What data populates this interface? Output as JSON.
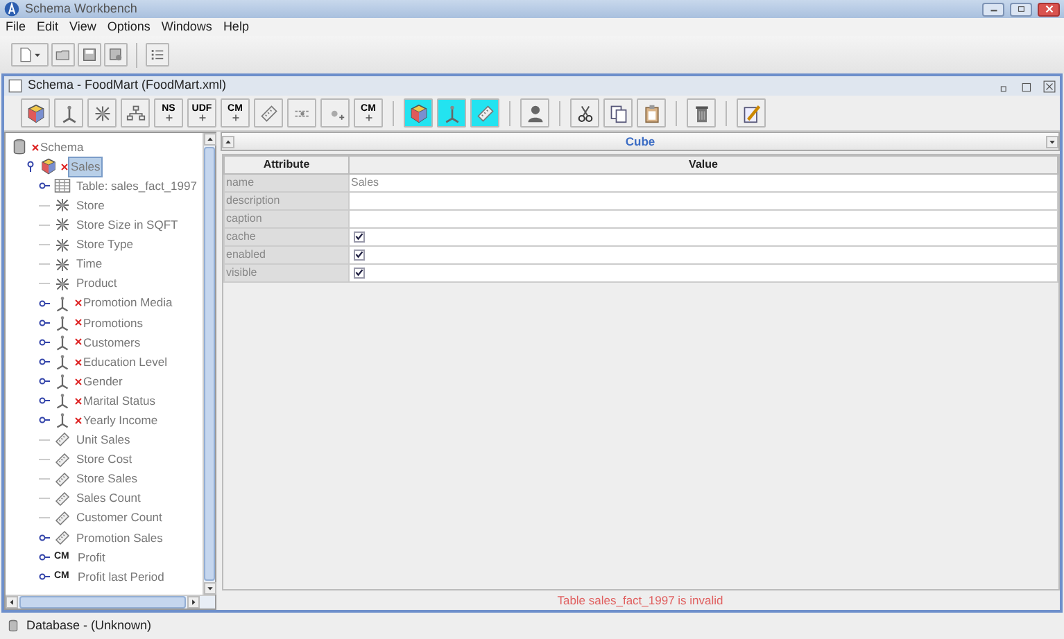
{
  "window": {
    "title": "Schema Workbench"
  },
  "menu": [
    {
      "label": "File"
    },
    {
      "label": "Edit"
    },
    {
      "label": "View"
    },
    {
      "label": "Options"
    },
    {
      "label": "Windows"
    },
    {
      "label": "Help"
    }
  ],
  "main_toolbar": [
    {
      "kind": "new-menu"
    },
    {
      "kind": "open"
    },
    {
      "kind": "save"
    },
    {
      "kind": "save-as"
    },
    {
      "kind": "sep"
    },
    {
      "kind": "preferences"
    }
  ],
  "frame": {
    "title": "Schema - FoodMart (FoodMart.xml)"
  },
  "frame_toolbar": [
    {
      "kind": "cube",
      "highlighted": false
    },
    {
      "kind": "dimension",
      "highlighted": false
    },
    {
      "kind": "star",
      "highlighted": false
    },
    {
      "kind": "hierarchy",
      "highlighted": false
    },
    {
      "kind": "text",
      "label": "NS",
      "highlighted": false
    },
    {
      "kind": "text",
      "label": "UDF",
      "highlighted": false
    },
    {
      "kind": "text",
      "label": "CM",
      "highlighted": false
    },
    {
      "kind": "measure",
      "highlighted": false
    },
    {
      "kind": "level",
      "highlighted": false
    },
    {
      "kind": "property",
      "highlighted": false
    },
    {
      "kind": "text",
      "label": "CM",
      "highlighted": false
    },
    {
      "kind": "sep"
    },
    {
      "kind": "cube",
      "highlighted": true
    },
    {
      "kind": "dimension",
      "highlighted": true
    },
    {
      "kind": "measure",
      "highlighted": true
    },
    {
      "kind": "sep"
    },
    {
      "kind": "person",
      "highlighted": false
    },
    {
      "kind": "sep"
    },
    {
      "kind": "cut",
      "highlighted": false
    },
    {
      "kind": "copy",
      "highlighted": false
    },
    {
      "kind": "paste",
      "highlighted": false
    },
    {
      "kind": "sep"
    },
    {
      "kind": "delete",
      "highlighted": false
    },
    {
      "kind": "sep"
    },
    {
      "kind": "edit",
      "highlighted": false
    }
  ],
  "tree": [
    {
      "label": "Schema",
      "kind": "schema",
      "invalid": true,
      "selected": false,
      "children": [
        {
          "label": "Sales",
          "kind": "cube",
          "invalid": true,
          "selected": true,
          "expanded": true,
          "children": [
            {
              "label": "Table: sales_fact_1997",
              "kind": "table",
              "invalid": false,
              "selected": false,
              "expanded": false
            },
            {
              "label": "Store",
              "kind": "shared",
              "invalid": false,
              "selected": false
            },
            {
              "label": "Store Size in SQFT",
              "kind": "shared",
              "invalid": false,
              "selected": false
            },
            {
              "label": "Store Type",
              "kind": "shared",
              "invalid": false,
              "selected": false
            },
            {
              "label": "Time",
              "kind": "shared",
              "invalid": false,
              "selected": false
            },
            {
              "label": "Product",
              "kind": "shared",
              "invalid": false,
              "selected": false
            },
            {
              "label": "Promotion Media",
              "kind": "dimension",
              "invalid": true,
              "selected": false,
              "expanded": false
            },
            {
              "label": "Promotions",
              "kind": "dimension",
              "invalid": true,
              "selected": false,
              "expanded": false
            },
            {
              "label": "Customers",
              "kind": "dimension",
              "invalid": true,
              "selected": false,
              "expanded": false
            },
            {
              "label": "Education Level",
              "kind": "dimension",
              "invalid": true,
              "selected": false,
              "expanded": false
            },
            {
              "label": "Gender",
              "kind": "dimension",
              "invalid": true,
              "selected": false,
              "expanded": false
            },
            {
              "label": "Marital Status",
              "kind": "dimension",
              "invalid": true,
              "selected": false,
              "expanded": false
            },
            {
              "label": "Yearly Income",
              "kind": "dimension",
              "invalid": true,
              "selected": false,
              "expanded": false
            },
            {
              "label": "Unit Sales",
              "kind": "measure",
              "invalid": false,
              "selected": false
            },
            {
              "label": "Store Cost",
              "kind": "measure",
              "invalid": false,
              "selected": false
            },
            {
              "label": "Store Sales",
              "kind": "measure",
              "invalid": false,
              "selected": false
            },
            {
              "label": "Sales Count",
              "kind": "measure",
              "invalid": false,
              "selected": false
            },
            {
              "label": "Customer Count",
              "kind": "measure",
              "invalid": false,
              "selected": false
            },
            {
              "label": "Promotion Sales",
              "kind": "measure",
              "invalid": false,
              "selected": false,
              "expanded": false
            },
            {
              "label": "Profit",
              "kind": "calc",
              "icon_text": "CM",
              "invalid": false,
              "selected": false,
              "expanded": false
            },
            {
              "label": "Profit last Period",
              "kind": "calc",
              "icon_text": "CM",
              "invalid": false,
              "selected": false,
              "expanded": false
            }
          ]
        }
      ]
    }
  ],
  "panel": {
    "title": "Cube",
    "columns": [
      "Attribute",
      "Value"
    ],
    "rows": [
      {
        "name": "name",
        "kind": "text",
        "value": "Sales"
      },
      {
        "name": "description",
        "kind": "text"
      },
      {
        "name": "caption",
        "kind": "text"
      },
      {
        "name": "cache",
        "kind": "checkbox",
        "checked": true
      },
      {
        "name": "enabled",
        "kind": "checkbox",
        "checked": true
      },
      {
        "name": "visible",
        "kind": "checkbox",
        "checked": true
      }
    ]
  },
  "message": "Table sales_fact_1997 is invalid",
  "status_bar": {
    "label": "Database - (Unknown)"
  }
}
